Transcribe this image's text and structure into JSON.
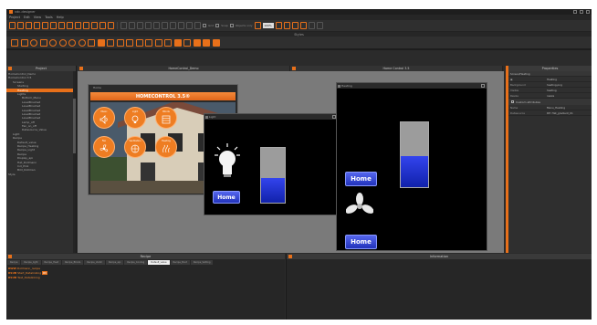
{
  "app": {
    "title": "vdc-designer"
  },
  "menu": [
    "Project",
    "Edit",
    "View",
    "Tools",
    "Help"
  ],
  "toolbar": {
    "zoom": "100%",
    "option1": "Grid",
    "option2": "Snap",
    "option3": "Objects only"
  },
  "styles_title": "Styles",
  "panels": {
    "project": "Project",
    "properties": "Properties",
    "recipe": "Recipe",
    "info": "Information"
  },
  "doc_tabs": [
    "HomeControl_Demo",
    "Home Control 3.5"
  ],
  "project_tree": [
    {
      "label": "HomeControl_Demo",
      "depth": 0
    },
    {
      "label": "HomeControl 3.5",
      "depth": 0
    },
    {
      "label": "Screens",
      "depth": 1
    },
    {
      "label": "Starting",
      "depth": 2
    },
    {
      "label": "Heating",
      "depth": 2,
      "selected": true
    },
    {
      "label": "Lights",
      "depth": 2
    },
    {
      "label": "Bottom_Menu",
      "depth": 3
    },
    {
      "label": "LevelBrushed",
      "depth": 3
    },
    {
      "label": "LevelBrushed",
      "depth": 3
    },
    {
      "label": "LevelBrushed",
      "depth": 3
    },
    {
      "label": "LevelBrushed",
      "depth": 3
    },
    {
      "label": "LevelBrushed",
      "depth": 3
    },
    {
      "label": "Lamp_off",
      "depth": 3
    },
    {
      "label": "Fan_on_off",
      "depth": 3
    },
    {
      "label": "Datasource_Value",
      "depth": 3
    },
    {
      "label": "Light",
      "depth": 1
    },
    {
      "label": "Recipe",
      "depth": 1
    },
    {
      "label": "Default_value",
      "depth": 2
    },
    {
      "label": "Recipe_Heating",
      "depth": 2
    },
    {
      "label": "Recipe_Light",
      "depth": 2
    },
    {
      "label": "Recipe",
      "depth": 2
    },
    {
      "label": "Display_api",
      "depth": 2
    },
    {
      "label": "Hat_Dollmann",
      "depth": 2
    },
    {
      "label": "Ind_Pink",
      "depth": 2
    },
    {
      "label": "Bild_Dollman",
      "depth": 2
    },
    {
      "label": "Style",
      "depth": 0
    }
  ],
  "homecontrol": {
    "window_title": "Home",
    "banner": "HOMECONTROL 3.5®",
    "buttons": [
      "Music",
      "Light",
      "Blinds",
      "Fan",
      "Ventilation",
      "Heating"
    ]
  },
  "light_window": {
    "title": "Light",
    "level": 0.45,
    "home_label": "Home"
  },
  "heating_window": {
    "title": "Heating",
    "level": 0.48,
    "home_label": "Home",
    "home_label_2": "Home"
  },
  "properties": {
    "header": "Screen/Heating",
    "name_label": "Heating",
    "rows": [
      {
        "k": "Background",
        "v": "heating.png"
      },
      {
        "k": "Visible",
        "v": "heating"
      },
      {
        "k": "Resize",
        "v": "resize"
      }
    ],
    "group": "Custom attributes",
    "rows2": [
      {
        "k": "Name",
        "v": "Menu_Heating"
      },
      {
        "k": "Datasource",
        "v": "DP: Hat_gradient_01"
      }
    ]
  },
  "recipe": {
    "tabs": [
      "Recipe",
      "Recipe_light",
      "Recipe_Heat",
      "Recipe_Blinds",
      "Recipe_Ventil",
      "Recipe_api",
      "Recipe_Cooling",
      "Default_value",
      "Recipe_Boot",
      "Recipe_Setting"
    ],
    "items": [
      {
        "icon": "RWW",
        "text": "Dollmann_recipe"
      },
      {
        "icon": "RSUB",
        "text": "Start_Datalinking",
        "highlight": "RV"
      },
      {
        "icon": "RSUB",
        "text": "Test_Datalinking"
      }
    ]
  },
  "colors": {
    "accent": "#e8701a",
    "background": "#2b2b2b",
    "home_button": "#2a3ad0"
  }
}
